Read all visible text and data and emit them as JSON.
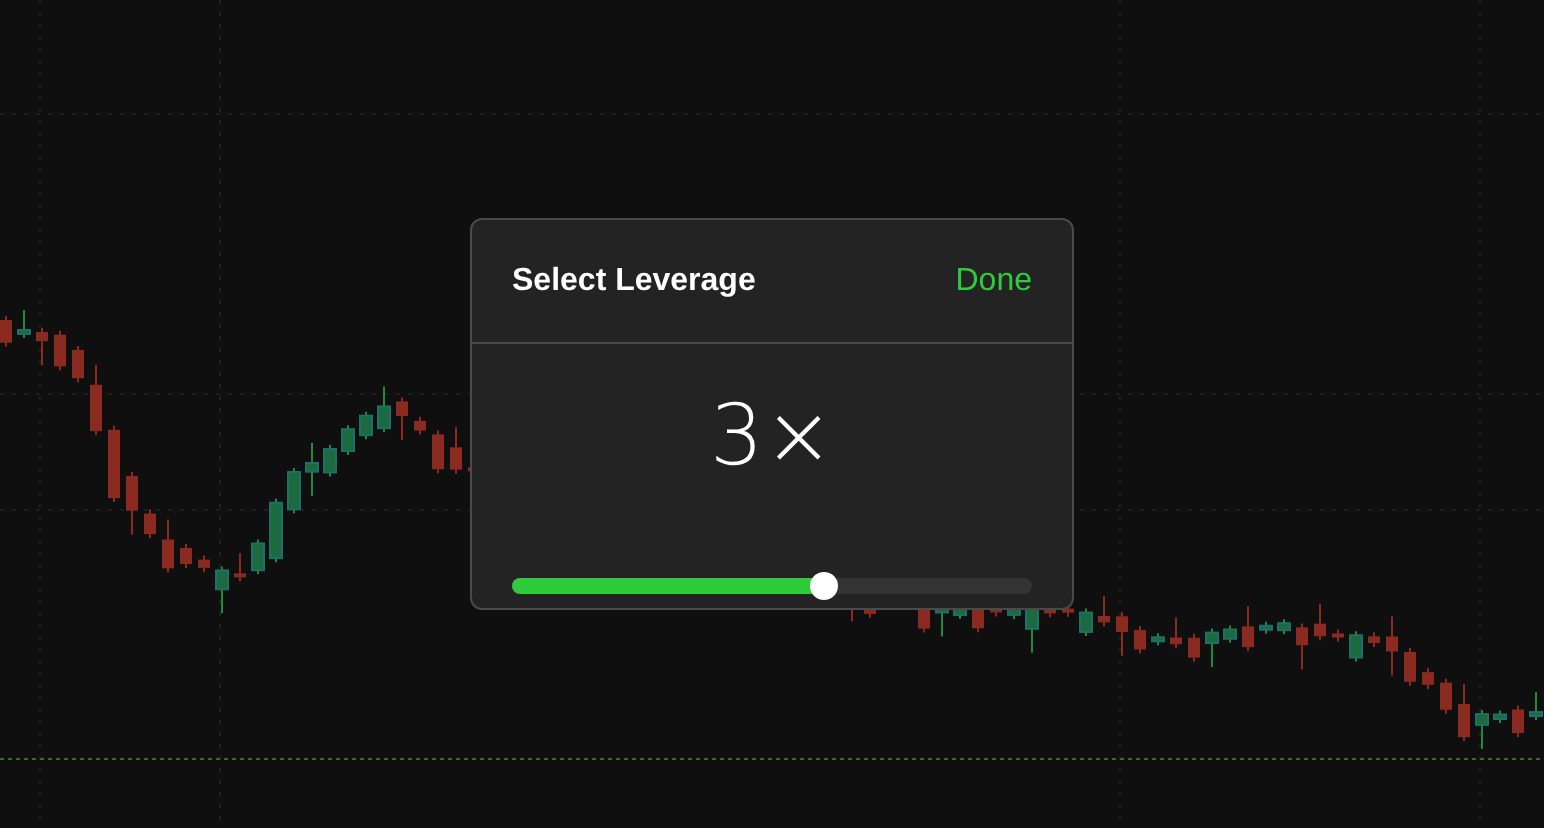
{
  "dialog": {
    "title": "Select Leverage",
    "done_button": "Done",
    "value": "3×",
    "slider": {
      "level": 0.6
    }
  }
}
